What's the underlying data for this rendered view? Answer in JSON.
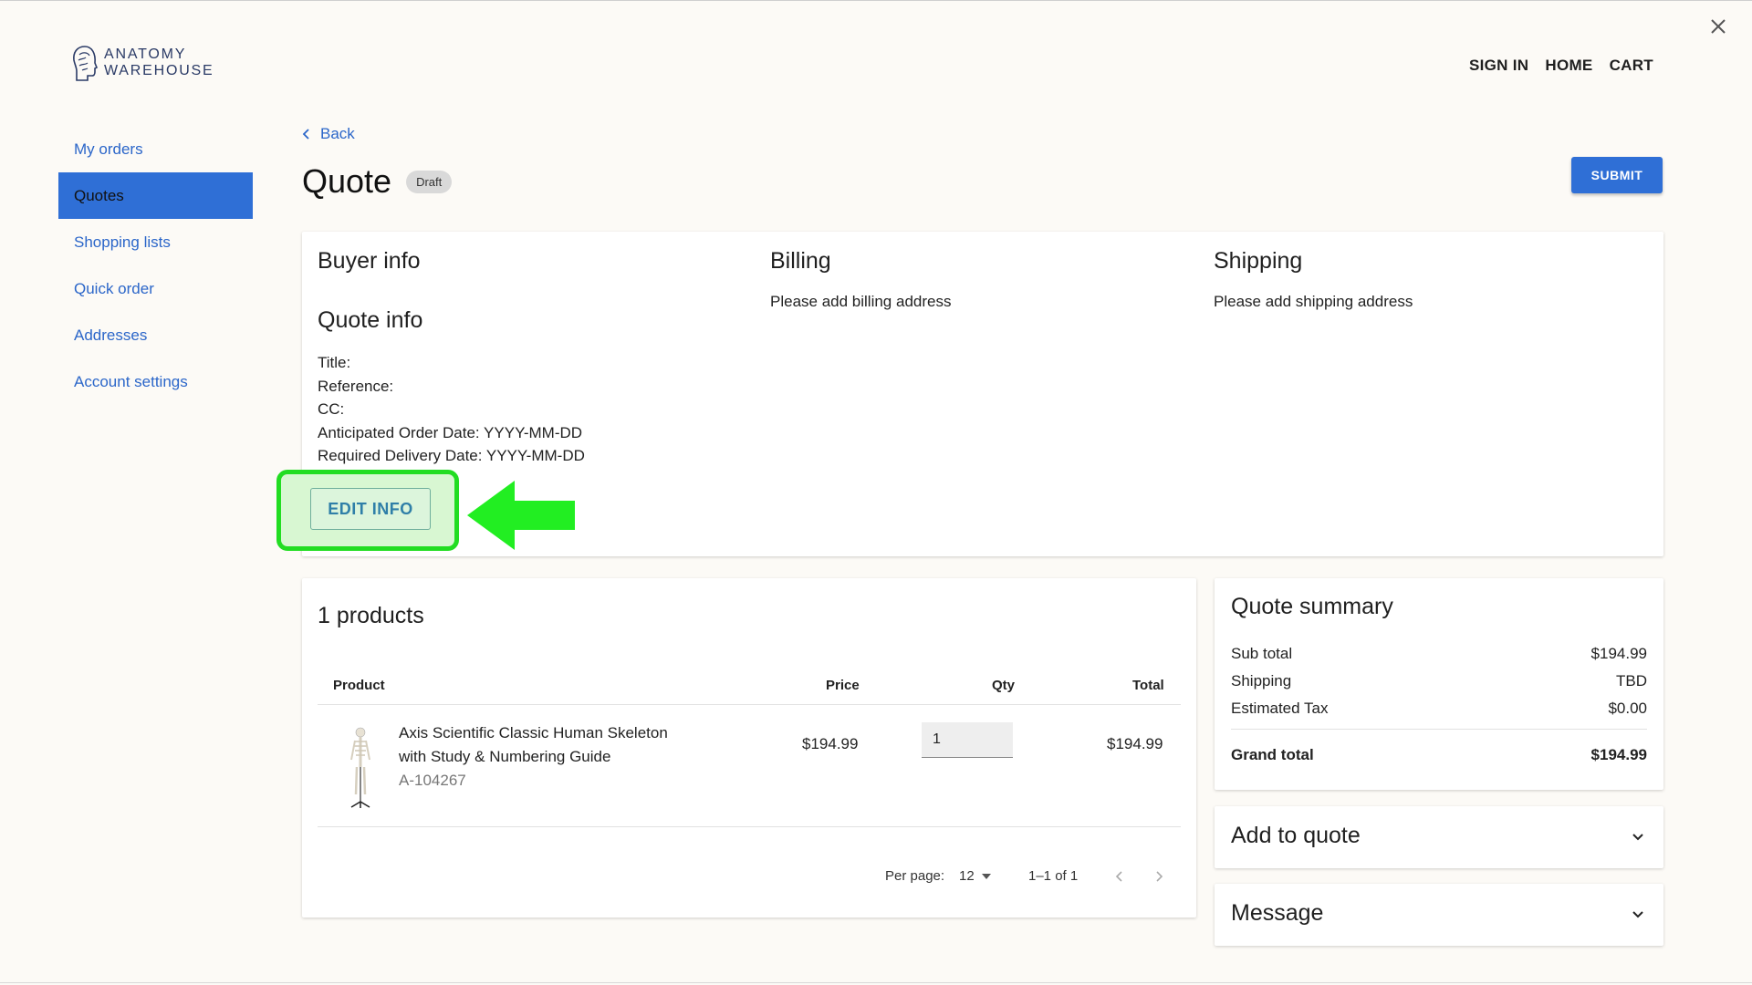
{
  "colors": {
    "accent": "#2f6fd6",
    "link": "#2b66c9",
    "highlight": "#22dd22",
    "background": "#fcfaf6"
  },
  "header": {
    "logo_line1": "ANATOMY",
    "logo_line2": "WAREHOUSE",
    "logo_icon": "head-profile-icon",
    "nav": [
      "SIGN IN",
      "HOME",
      "CART"
    ],
    "close_icon": "close-icon"
  },
  "sidebar": {
    "items": [
      {
        "label": "My orders",
        "active": false
      },
      {
        "label": "Quotes",
        "active": true
      },
      {
        "label": "Shopping lists",
        "active": false
      },
      {
        "label": "Quick order",
        "active": false
      },
      {
        "label": "Addresses",
        "active": false
      },
      {
        "label": "Account settings",
        "active": false
      }
    ]
  },
  "page": {
    "back_label": "Back",
    "title": "Quote",
    "status_badge": "Draft",
    "submit_label": "SUBMIT"
  },
  "info": {
    "buyer_heading": "Buyer info",
    "quote_heading": "Quote info",
    "fields": {
      "title": "Title:",
      "reference": "Reference:",
      "cc": "CC:",
      "anticipated": "Anticipated Order Date: YYYY-MM-DD",
      "required": "Required Delivery Date: YYYY-MM-DD"
    },
    "edit_label": "EDIT INFO",
    "billing_heading": "Billing",
    "billing_text": "Please add billing address",
    "shipping_heading": "Shipping",
    "shipping_text": "Please add shipping address"
  },
  "products": {
    "heading": "1 products",
    "columns": {
      "product": "Product",
      "price": "Price",
      "qty": "Qty",
      "total": "Total"
    },
    "rows": [
      {
        "name_line1": "Axis Scientific Classic Human Skeleton",
        "name_line2": "with Study & Numbering Guide",
        "sku": "A-104267",
        "price": "$194.99",
        "qty": "1",
        "total": "$194.99"
      }
    ],
    "per_page_label": "Per page:",
    "per_page_value": "12",
    "range": "1–1 of 1"
  },
  "summary": {
    "heading": "Quote summary",
    "rows": [
      {
        "label": "Sub total",
        "value": "$194.99"
      },
      {
        "label": "Shipping",
        "value": "TBD"
      },
      {
        "label": "Estimated Tax",
        "value": "$0.00"
      }
    ],
    "grand_label": "Grand total",
    "grand_value": "$194.99"
  },
  "accordions": [
    "Add to quote",
    "Message"
  ]
}
